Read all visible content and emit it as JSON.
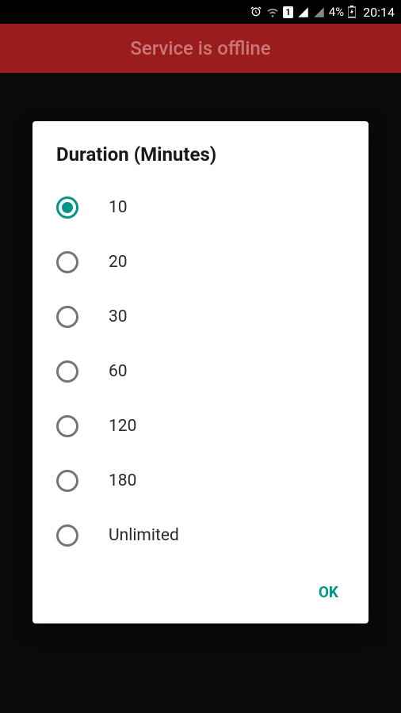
{
  "statusBar": {
    "battery": "4%",
    "time": "20:14"
  },
  "header": {
    "title": "Service is offline"
  },
  "dialog": {
    "title": "Duration (Minutes)",
    "options": [
      {
        "label": "10",
        "selected": true
      },
      {
        "label": "20",
        "selected": false
      },
      {
        "label": "30",
        "selected": false
      },
      {
        "label": "60",
        "selected": false
      },
      {
        "label": "120",
        "selected": false
      },
      {
        "label": "180",
        "selected": false
      },
      {
        "label": "Unlimited",
        "selected": false
      }
    ],
    "okLabel": "OK"
  }
}
